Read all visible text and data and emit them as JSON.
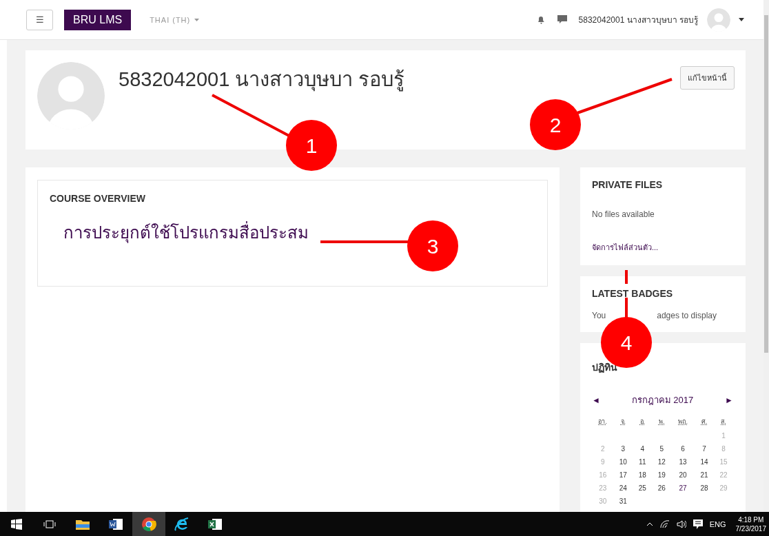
{
  "navbar": {
    "menu_button": "☰",
    "brand": "BRU LMS",
    "language": "THAI (TH)",
    "user_name": "5832042001 นางสาวบุษบา รอบรู้"
  },
  "header": {
    "title": "5832042001 นางสาวบุษบา รอบรู้",
    "edit_button": "แก้ไขหน้านี้"
  },
  "course_overview": {
    "title": "COURSE OVERVIEW",
    "courses": [
      "การประยุกต์ใช้โปรแกรมสื่อประสม"
    ]
  },
  "private_files": {
    "title": "PRIVATE FILES",
    "message": "No files available",
    "link": "จัดการไฟล์ส่วนตัว..."
  },
  "latest_badges": {
    "title": "LATEST BADGES",
    "message_parts": [
      "You",
      "adges to display"
    ]
  },
  "calendar": {
    "title": "ปฏิทิน",
    "prev": "◄",
    "month": "กรกฎาคม 2017",
    "next": "►",
    "weekdays": [
      "อา.",
      "จ.",
      "อ.",
      "พ.",
      "พฤ.",
      "ศ.",
      "ส."
    ],
    "weeks": [
      [
        {
          "d": "1",
          "event": false
        }
      ],
      [
        {
          "d": "2",
          "event": false
        },
        {
          "d": "3",
          "event": false
        },
        {
          "d": "4",
          "event": false
        },
        {
          "d": "5",
          "event": false
        },
        {
          "d": "6",
          "event": false
        },
        {
          "d": "7",
          "event": false
        },
        {
          "d": "8",
          "event": false
        }
      ],
      [
        {
          "d": "9",
          "event": false
        },
        {
          "d": "10",
          "event": false
        },
        {
          "d": "11",
          "event": false
        },
        {
          "d": "12",
          "event": false
        },
        {
          "d": "13",
          "event": false
        },
        {
          "d": "14",
          "event": false
        },
        {
          "d": "15",
          "event": false
        }
      ],
      [
        {
          "d": "16",
          "event": false
        },
        {
          "d": "17",
          "event": false
        },
        {
          "d": "18",
          "event": false
        },
        {
          "d": "19",
          "event": false
        },
        {
          "d": "20",
          "event": false
        },
        {
          "d": "21",
          "event": false
        },
        {
          "d": "22",
          "event": false
        }
      ],
      [
        {
          "d": "23",
          "event": false
        },
        {
          "d": "24",
          "event": false
        },
        {
          "d": "25",
          "event": false
        },
        {
          "d": "26",
          "event": false
        },
        {
          "d": "27",
          "event": true
        },
        {
          "d": "28",
          "event": false
        },
        {
          "d": "29",
          "event": false
        }
      ],
      [
        {
          "d": "30",
          "event": false
        },
        {
          "d": "31",
          "event": false
        }
      ]
    ]
  },
  "annotations": [
    {
      "label": "1"
    },
    {
      "label": "2"
    },
    {
      "label": "3"
    },
    {
      "label": "4"
    }
  ],
  "taskbar": {
    "apps": [
      {
        "kind": "files",
        "selected": false
      },
      {
        "kind": "word",
        "selected": false
      },
      {
        "kind": "chrome",
        "selected": true
      },
      {
        "kind": "ie",
        "selected": false
      },
      {
        "kind": "excel",
        "selected": false
      }
    ],
    "language": "ENG",
    "time": "4:18 PM",
    "date": "7/23/2017"
  }
}
